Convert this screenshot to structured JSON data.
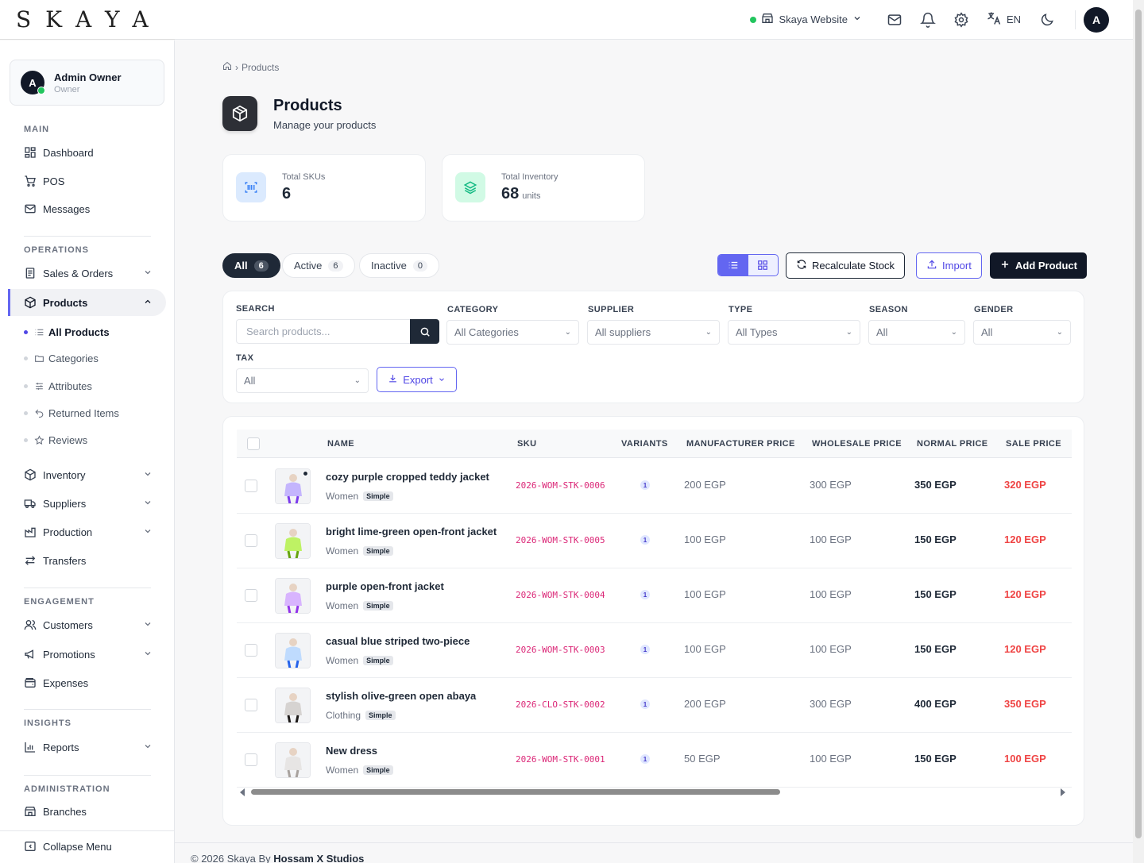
{
  "brand": {
    "logo": "SKAYA"
  },
  "topbar": {
    "site_name": "Skaya Website",
    "lang": "EN",
    "avatar": "A"
  },
  "user": {
    "initial": "A",
    "name": "Admin Owner",
    "role": "Owner"
  },
  "nav": {
    "main_label": "MAIN",
    "dashboard": "Dashboard",
    "pos": "POS",
    "messages": "Messages",
    "operations_label": "OPERATIONS",
    "sales_orders": "Sales & Orders",
    "products": "Products",
    "sub": {
      "all_products": "All Products",
      "categories": "Categories",
      "attributes": "Attributes",
      "returned_items": "Returned Items",
      "reviews": "Reviews"
    },
    "inventory": "Inventory",
    "suppliers": "Suppliers",
    "production": "Production",
    "transfers": "Transfers",
    "engagement_label": "ENGAGEMENT",
    "customers": "Customers",
    "promotions": "Promotions",
    "expenses": "Expenses",
    "insights_label": "INSIGHTS",
    "reports": "Reports",
    "administration_label": "ADMINISTRATION",
    "branches": "Branches",
    "collapse": "Collapse Menu"
  },
  "breadcrumb": {
    "current": "Products"
  },
  "page": {
    "title": "Products",
    "subtitle": "Manage your products"
  },
  "stats": {
    "skus_label": "Total SKUs",
    "skus_value": "6",
    "inventory_label": "Total Inventory",
    "inventory_value": "68",
    "inventory_unit": "units"
  },
  "tabs": {
    "all": "All",
    "all_count": "6",
    "active": "Active",
    "active_count": "6",
    "inactive": "Inactive",
    "inactive_count": "0"
  },
  "actions": {
    "recalculate": "Recalculate Stock",
    "import": "Import",
    "add": "Add Product"
  },
  "filters": {
    "search_label": "SEARCH",
    "search_placeholder": "Search products...",
    "category_label": "CATEGORY",
    "category_value": "All Categories",
    "supplier_label": "SUPPLIER",
    "supplier_value": "All suppliers",
    "type_label": "TYPE",
    "type_value": "All Types",
    "season_label": "SEASON",
    "season_value": "All",
    "gender_label": "GENDER",
    "gender_value": "All",
    "tax_label": "TAX",
    "tax_value": "All",
    "export": "Export"
  },
  "table": {
    "headers": {
      "name": "NAME",
      "sku": "SKU",
      "variants": "VARIANTS",
      "manufacturer": "MANUFACTURER PRICE",
      "wholesale": "WHOLESALE PRICE",
      "normal": "NORMAL PRICE",
      "sale": "SALE PRICE"
    },
    "rows": [
      {
        "name": "cozy purple cropped teddy jacket",
        "category": "Women",
        "type": "Simple",
        "sku": "2026-WOM-STK-0006",
        "variants": "1",
        "manufacturer": "200 EGP",
        "wholesale": "300 EGP",
        "normal": "350 EGP",
        "sale": "320 EGP"
      },
      {
        "name": "bright lime-green open-front jacket",
        "category": "Women",
        "type": "Simple",
        "sku": "2026-WOM-STK-0005",
        "variants": "1",
        "manufacturer": "100 EGP",
        "wholesale": "100 EGP",
        "normal": "150 EGP",
        "sale": "120 EGP"
      },
      {
        "name": "purple open-front jacket",
        "category": "Women",
        "type": "Simple",
        "sku": "2026-WOM-STK-0004",
        "variants": "1",
        "manufacturer": "100 EGP",
        "wholesale": "100 EGP",
        "normal": "150 EGP",
        "sale": "120 EGP"
      },
      {
        "name": "casual blue striped two-piece",
        "category": "Women",
        "type": "Simple",
        "sku": "2026-WOM-STK-0003",
        "variants": "1",
        "manufacturer": "100 EGP",
        "wholesale": "100 EGP",
        "normal": "150 EGP",
        "sale": "120 EGP"
      },
      {
        "name": "stylish olive-green open abaya",
        "category": "Clothing",
        "type": "Simple",
        "sku": "2026-CLO-STK-0002",
        "variants": "1",
        "manufacturer": "200 EGP",
        "wholesale": "300 EGP",
        "normal": "400 EGP",
        "sale": "350 EGP"
      },
      {
        "name": "New dress",
        "category": "Women",
        "type": "Simple",
        "sku": "2026-WOM-STK-0001",
        "variants": "1",
        "manufacturer": "50 EGP",
        "wholesale": "100 EGP",
        "normal": "150 EGP",
        "sale": "100 EGP"
      }
    ]
  },
  "footer": {
    "prefix": "© 2026 Skaya By",
    "studio": "Hossam X Studios"
  }
}
